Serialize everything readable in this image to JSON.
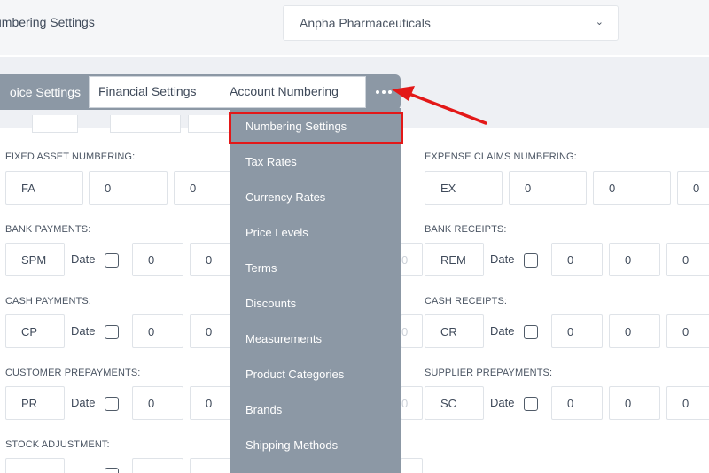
{
  "header": {
    "title": "umbering Settings",
    "company_select": {
      "value": "Anpha Pharmaceuticals",
      "icon": "chevron-down-icon"
    }
  },
  "tabs": {
    "active": "oice Settings",
    "financial": "Financial Settings",
    "account": "Account Numbering",
    "more_icon": "more-horizontal-icon"
  },
  "dropdown": {
    "items": [
      "Numbering Settings",
      "Tax Rates",
      "Currency Rates",
      "Price Levels",
      "Terms",
      "Discounts",
      "Measurements",
      "Product Categories",
      "Brands",
      "Shipping Methods"
    ],
    "highlighted_item": "Numbering Settings"
  },
  "annotation": {
    "color": "#e31818"
  },
  "sections": {
    "fixed_asset": {
      "label": "FIXED ASSET NUMBERING:",
      "prefix": "FA",
      "v1": "0",
      "v2": "0"
    },
    "expense_claims": {
      "label": "EXPENSE CLAIMS NUMBERING:",
      "prefix": "EX",
      "v1": "0",
      "v2": "0",
      "v3": "0"
    },
    "bank_payments": {
      "label": "BANK PAYMENTS:",
      "prefix": "SPM",
      "date_label": "Date",
      "v1": "0",
      "v2": "0"
    },
    "bank_receipts": {
      "label": "BANK RECEIPTS:",
      "prefix": "REM",
      "date_label": "Date",
      "v1": "0",
      "v2": "0",
      "v3": "0",
      "ghost": "0"
    },
    "cash_payments": {
      "label": "CASH PAYMENTS:",
      "prefix": "CP",
      "date_label": "Date",
      "v1": "0",
      "v2": "0"
    },
    "cash_receipts": {
      "label": "CASH RECEIPTS:",
      "prefix": "CR",
      "date_label": "Date",
      "v1": "0",
      "v2": "0",
      "v3": "0",
      "ghost": "0"
    },
    "customer_prepayments": {
      "label": "CUSTOMER PREPAYMENTS:",
      "prefix": "PR",
      "date_label": "Date",
      "v1": "0",
      "v2": "0"
    },
    "supplier_prepayments": {
      "label": "SUPPLIER PREPAYMENTS:",
      "prefix": "SC",
      "date_label": "Date",
      "v1": "0",
      "v2": "0",
      "v3": "0",
      "ghost": "0"
    },
    "stock_adjustment": {
      "label": "STOCK ADJUSTMENT:"
    }
  }
}
